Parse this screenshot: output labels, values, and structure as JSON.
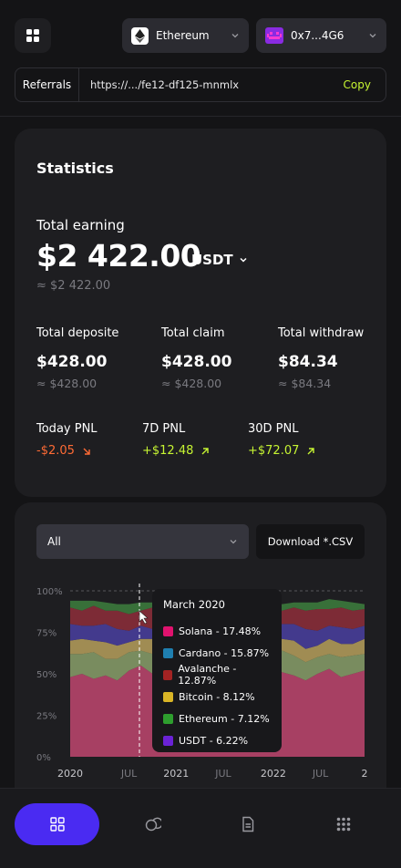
{
  "header": {
    "chain": "Ethereum",
    "wallet": "0x7...4G6"
  },
  "referral": {
    "label": "Referrals",
    "url": "https://.../fe12-df125-mnmlx",
    "copy_label": "Copy"
  },
  "stats": {
    "title": "Statistics",
    "total_earning_label": "Total earning",
    "total_earning": "$2 422.00",
    "unit": "USDT",
    "total_earning_approx": "≈ $2 422.00",
    "metrics": [
      {
        "label": "Total deposite",
        "value": "$428.00",
        "approx": "≈ $428.00"
      },
      {
        "label": "Total claim",
        "value": "$428.00",
        "approx": "≈ $428.00"
      },
      {
        "label": "Total withdraw",
        "value": "$84.34",
        "approx": "≈ $84.34"
      }
    ],
    "pnl": [
      {
        "label": "Today PNL",
        "value": "-$2.05",
        "trend": "down"
      },
      {
        "label": "7D PNL",
        "value": "+$12.48",
        "trend": "up"
      },
      {
        "label": "30D PNL",
        "value": "+$72.07",
        "trend": "up"
      }
    ]
  },
  "chart_controls": {
    "filter": "All",
    "download_label": "Download *.CSV"
  },
  "tooltip": {
    "title": "March 2020",
    "items": [
      {
        "label": "Solana - 17.48%",
        "color": "#e0126e"
      },
      {
        "label": "Cardano - 15.87%",
        "color": "#1f7fb0"
      },
      {
        "label": "Avalanche - 12.87%",
        "color": "#a32323"
      },
      {
        "label": "Bitcoin - 8.12%",
        "color": "#d9b526"
      },
      {
        "label": "Ethereum - 7.12%",
        "color": "#2e9e2e"
      },
      {
        "label": "USDT - 6.22%",
        "color": "#6b22d6"
      }
    ]
  },
  "chart_data": {
    "type": "area",
    "y_ticks": [
      "100%",
      "75%",
      "50%",
      "25%",
      "0%"
    ],
    "x_ticks": [
      "2020",
      "JUL",
      "2021",
      "JUL",
      "2022",
      "JUL",
      "2"
    ],
    "ylim": [
      0,
      100
    ],
    "x": [
      0,
      1,
      2,
      3,
      4,
      5,
      6,
      7,
      8,
      9,
      10,
      11,
      12,
      13,
      14,
      15,
      16,
      17,
      18,
      19,
      20,
      21,
      22,
      23,
      24,
      25
    ],
    "series": [
      {
        "name": "Solana",
        "color": "#c0476f",
        "values": [
          48,
          50,
          47,
          49,
          46,
          52,
          55,
          50,
          48,
          51,
          53,
          49,
          50,
          52,
          48,
          47,
          50,
          54,
          51,
          49,
          46,
          50,
          53,
          48,
          50,
          52
        ]
      },
      {
        "name": "Cardano",
        "color": "#8aa06a",
        "values": [
          14,
          12,
          16,
          10,
          13,
          11,
          9,
          12,
          14,
          10,
          12,
          13,
          11,
          10,
          12,
          14,
          9,
          10,
          13,
          12,
          11,
          10,
          9,
          12,
          11,
          10
        ]
      },
      {
        "name": "Bitcoin",
        "color": "#b7a05c",
        "values": [
          8,
          9,
          7,
          10,
          8,
          6,
          7,
          9,
          8,
          7,
          6,
          8,
          9,
          7,
          8,
          6,
          10,
          8,
          7,
          9,
          8,
          7,
          9,
          8,
          7,
          9
        ]
      },
      {
        "name": "USDT",
        "color": "#4a3fa0",
        "values": [
          10,
          8,
          9,
          11,
          10,
          7,
          8,
          6,
          9,
          11,
          10,
          8,
          7,
          9,
          10,
          11,
          8,
          7,
          9,
          10,
          12,
          9,
          8,
          10,
          9,
          8
        ]
      },
      {
        "name": "Avalanche",
        "color": "#8e2e3a",
        "values": [
          10,
          9,
          12,
          8,
          11,
          10,
          9,
          13,
          10,
          9,
          8,
          11,
          12,
          9,
          10,
          12,
          11,
          9,
          8,
          10,
          11,
          13,
          10,
          12,
          11,
          10
        ]
      },
      {
        "name": "Ethereum",
        "color": "#3d7f3d",
        "values": [
          4,
          6,
          3,
          5,
          4,
          6,
          5,
          3,
          4,
          6,
          5,
          4,
          3,
          6,
          5,
          4,
          5,
          6,
          4,
          3,
          5,
          4,
          6,
          4,
          5,
          3
        ]
      }
    ]
  },
  "nav": {
    "items": [
      "dashboard-icon",
      "coins-icon",
      "document-icon",
      "apps-icon"
    ]
  }
}
